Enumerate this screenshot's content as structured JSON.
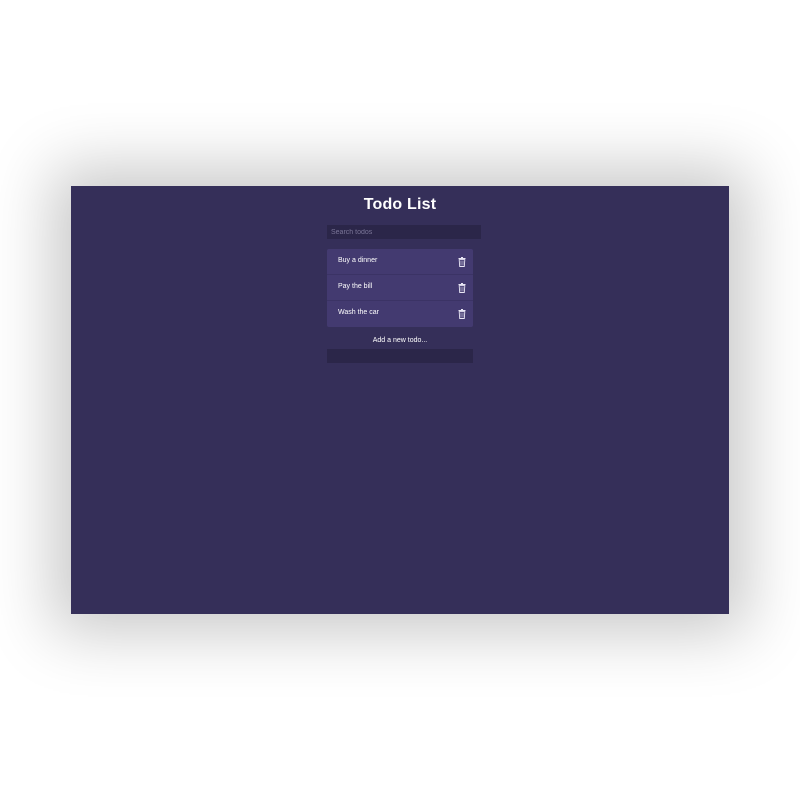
{
  "app": {
    "title": "Todo List"
  },
  "search": {
    "placeholder": "Search todos",
    "value": ""
  },
  "todos": [
    {
      "label": "Buy a dinner",
      "icon": "trash-icon"
    },
    {
      "label": "Pay the bill",
      "icon": "trash-icon"
    },
    {
      "label": "Wash the car",
      "icon": "trash-icon"
    }
  ],
  "add": {
    "label": "Add a new todo...",
    "value": ""
  },
  "colors": {
    "background": "#352f59",
    "list_background": "#433a70",
    "input_background": "#2b2649",
    "text": "#ffffff"
  }
}
